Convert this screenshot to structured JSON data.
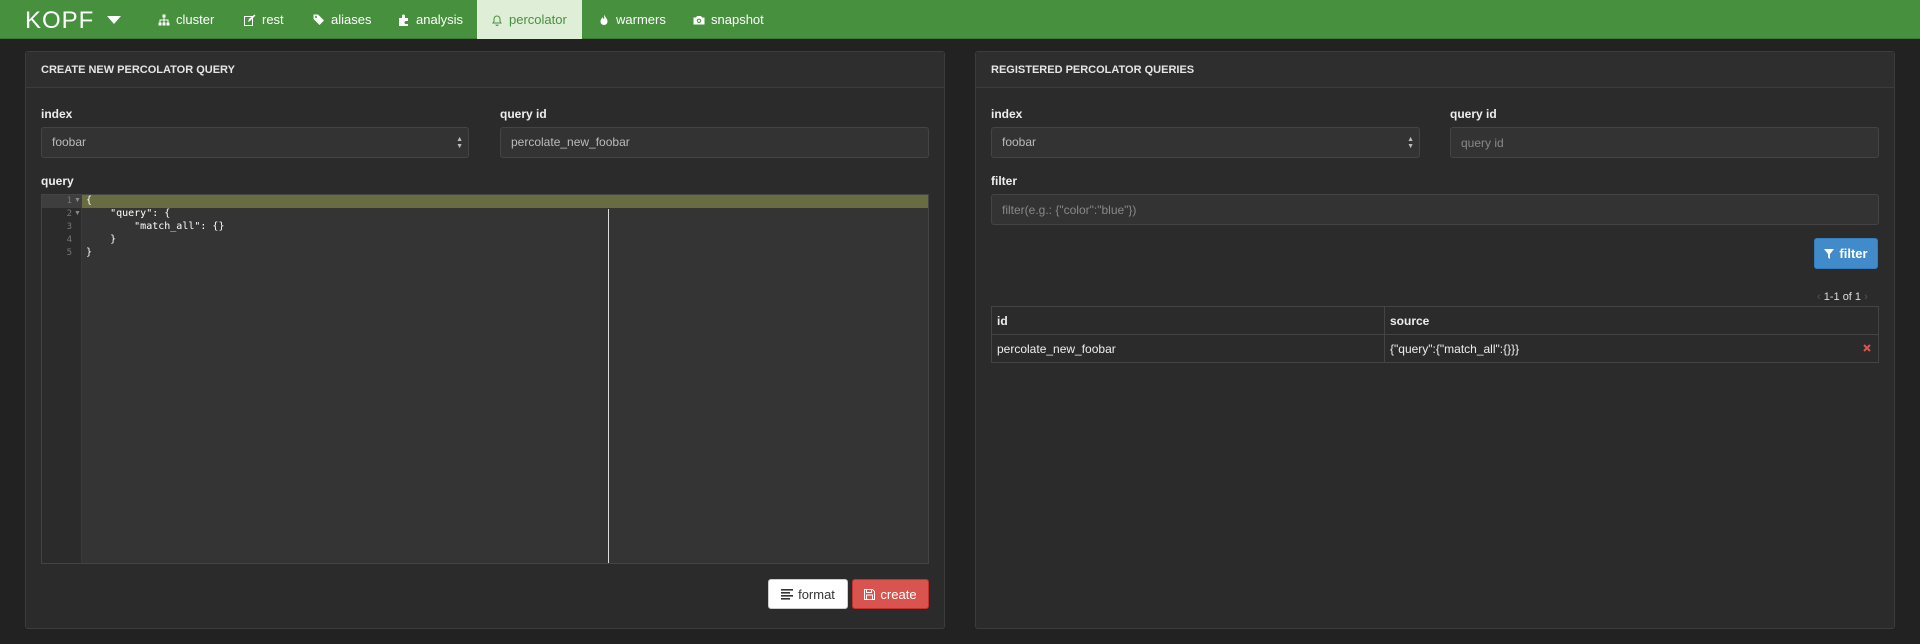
{
  "brand": "KOPF",
  "nav": [
    {
      "label": "cluster",
      "icon": "sitemap-icon"
    },
    {
      "label": "rest",
      "icon": "edit-icon"
    },
    {
      "label": "aliases",
      "icon": "tags-icon"
    },
    {
      "label": "analysis",
      "icon": "puzzle-icon"
    },
    {
      "label": "percolator",
      "icon": "bell-icon",
      "active": true
    },
    {
      "label": "warmers",
      "icon": "fire-icon"
    },
    {
      "label": "snapshot",
      "icon": "camera-icon"
    }
  ],
  "create_panel": {
    "title": "CREATE NEW PERCOLATOR QUERY",
    "index_label": "index",
    "index_value": "foobar",
    "query_id_label": "query id",
    "query_id_value": "percolate_new_foobar",
    "query_label": "query",
    "editor": {
      "line_numbers": [
        "1",
        "2",
        "3",
        "4",
        "5"
      ],
      "lines": [
        "{",
        "    \"query\": {",
        "        \"match_all\": {}",
        "    }",
        "}"
      ]
    },
    "format_label": "format",
    "create_label": "create"
  },
  "registered_panel": {
    "title": "REGISTERED PERCOLATOR QUERIES",
    "index_label": "index",
    "index_value": "foobar",
    "query_id_label": "query id",
    "query_id_placeholder": "query id",
    "filter_label": "filter",
    "filter_placeholder": "filter(e.g.: {\"color\":\"blue\"})",
    "filter_button": "filter",
    "pagination": "1-1 of 1",
    "table": {
      "headers": [
        "id",
        "source"
      ],
      "rows": [
        {
          "id": "percolate_new_foobar",
          "source": "{\"query\":{\"match_all\":{}}}"
        }
      ]
    }
  },
  "colors": {
    "navbar": "#47903e",
    "active_nav": "#dfeed6",
    "create_button": "#d9534f",
    "filter_button": "#428bca",
    "active_line": "#686c40"
  }
}
